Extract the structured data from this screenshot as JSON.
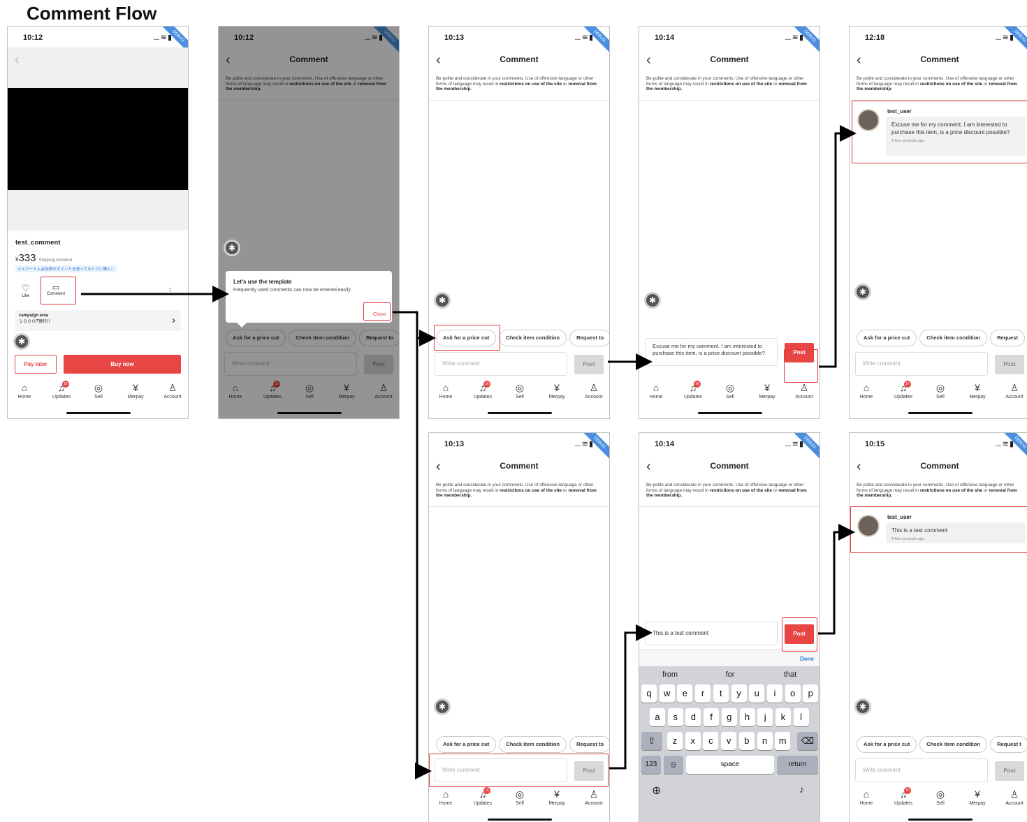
{
  "title": "Comment Flow",
  "common": {
    "comment_title": "Comment",
    "policy_pre": "Be polite and considerate in your comments. Use of offensive language or other forms of language may result in ",
    "policy_b1": "restrictions on use of the site",
    "policy_mid": " or ",
    "policy_b2": "removal from the membership.",
    "debug": "DEBUG",
    "back": "‹",
    "write_placeholder": "Write comment",
    "post": "Post",
    "chips": [
      "Ask for a price cut",
      "Check item condition",
      "Request to"
    ],
    "tabs": [
      "Home",
      "Updates",
      "Sell",
      "Merpay",
      "Account"
    ],
    "badge": "16",
    "badge2": "17",
    "badge3": "15"
  },
  "screen1": {
    "time": "10:12",
    "item_name": "test_comment",
    "currency": "¥",
    "price": "333",
    "shipping": "Shipping included",
    "promo": "メルカード入会特典のポイントを使っておトクに購入！",
    "like": "Like",
    "comment": "Comment",
    "campaign_title": "campaign area",
    "campaign_text": "１０００円割引！",
    "pay_later": "Pay later",
    "buy_now": "Buy now",
    "more": "⋮",
    "chevron": "›"
  },
  "screen2": {
    "time": "10:12",
    "tooltip_title": "Let's use the template",
    "tooltip_text": "Frequently used comments can now be entered easily.",
    "close": "Close",
    "chips": [
      "Ask for a price cut",
      "Check item condition",
      "Request to"
    ]
  },
  "screen3": {
    "time": "10:13"
  },
  "screen4": {
    "time": "10:14",
    "input_text": "Excuse me for my comment. I am interested to purchase this item, is a price discount possible?"
  },
  "screen5": {
    "time": "12:18",
    "user": "test_user",
    "comment": "Excuse me for my comment. I am interested to purchase this item, is a price discount possible?",
    "ago": "A few seconds ago",
    "chips": [
      "Ask for a price cut",
      "Check item condition",
      "Request"
    ]
  },
  "screen6": {
    "time": "10:13"
  },
  "screen7": {
    "time": "10:14",
    "input_text": "This is a test comment",
    "done": "Done",
    "suggestions": [
      "from",
      "for",
      "that"
    ],
    "row1": [
      "q",
      "w",
      "e",
      "r",
      "t",
      "y",
      "u",
      "i",
      "o",
      "p"
    ],
    "row2": [
      "a",
      "s",
      "d",
      "f",
      "g",
      "h",
      "j",
      "k",
      "l"
    ],
    "row3": [
      "z",
      "x",
      "c",
      "v",
      "b",
      "n",
      "m"
    ],
    "num": "123",
    "space": "space",
    "ret": "return"
  },
  "screen8": {
    "time": "10:15",
    "user": "test_user",
    "comment": "This is a test comment",
    "ago": "A few seconds ago",
    "chips": [
      "Ask for a price cut",
      "Check item condition",
      "Request t"
    ]
  },
  "colors": {
    "accent": "#e84545",
    "highlight": "#e23a3a",
    "debug": "#4a8fe0"
  }
}
